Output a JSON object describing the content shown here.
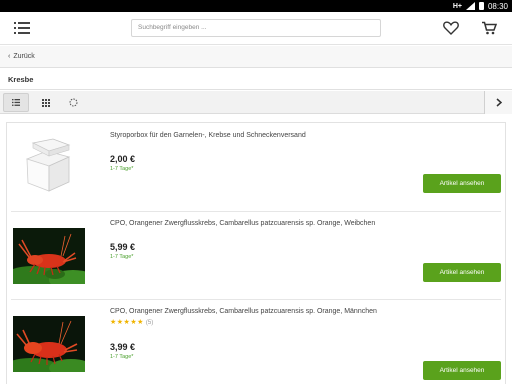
{
  "statusbar": {
    "network": "H+",
    "time": "08:30"
  },
  "header": {
    "search_placeholder": "Suchbegriff eingeben ..."
  },
  "nav": {
    "back_label": "Zurück"
  },
  "category": {
    "title": "Kresbe"
  },
  "products": [
    {
      "name": "Styroporbox für den Garnelen-, Krebse und Schneckenversand",
      "price": "2,00 €",
      "shipping": "1-7 Tage*",
      "button": "Artikel ansehen"
    },
    {
      "name": "CPO, Orangener Zwergflusskrebs, Cambarellus patzcuarensis sp. Orange, Weibchen",
      "price": "5,99 €",
      "shipping": "1-7 Tage*",
      "button": "Artikel ansehen"
    },
    {
      "name": "CPO, Orangener Zwergflusskrebs, Cambarellus patzcuarensis sp. Orange, Männchen",
      "rating_stars": "★★★★★",
      "rating_count": "(5)",
      "price": "3,99 €",
      "shipping": "1-7 Tage*",
      "button": "Artikel ansehen"
    }
  ],
  "colors": {
    "accent": "#5aa21c",
    "shipping": "#4aa02c",
    "stars": "#f0b400"
  },
  "icons": [
    "menu-icon",
    "heart-icon",
    "cart-icon",
    "list-view-icon",
    "grid-view-icon",
    "filter-icon",
    "chevron-right-icon"
  ]
}
